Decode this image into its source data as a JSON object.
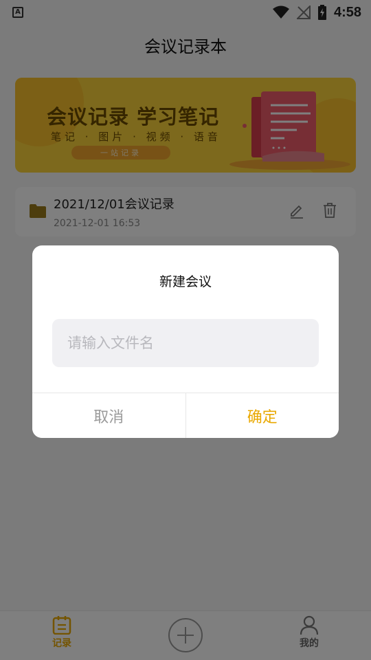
{
  "status_bar": {
    "time": "4:58",
    "left_icon_letter": "A",
    "icons": [
      "app-notification-icon",
      "wifi-icon",
      "no-signal-icon",
      "battery-charging-icon"
    ]
  },
  "header": {
    "title": "会议记录本"
  },
  "banner": {
    "title": "会议记录 学习笔记",
    "subtitle": "笔记 · 图片 · 视频 · 语音",
    "pill": "一站记录",
    "colors": {
      "background": "#fbd23a",
      "accent": "#f9c12d",
      "text": "#6a4a00"
    }
  },
  "records": [
    {
      "title": "2021/12/01会议记录",
      "time": "2021-12-01 16:53",
      "icons": [
        "folder-icon",
        "edit-icon",
        "trash-icon"
      ]
    }
  ],
  "dialog": {
    "title": "新建会议",
    "input_placeholder": "请输入文件名",
    "input_value": "",
    "cancel_label": "取消",
    "confirm_label": "确定"
  },
  "bottom_nav": {
    "items": [
      {
        "label": "记录",
        "icon": "clipboard-icon",
        "active": true
      },
      {
        "label": "",
        "icon": "add-icon",
        "active": false
      },
      {
        "label": "我的",
        "icon": "person-icon",
        "active": false
      }
    ]
  },
  "colors": {
    "accent": "#e9a800",
    "overlay": "rgba(0,0,0,0.5)",
    "card": "#ffffff"
  }
}
